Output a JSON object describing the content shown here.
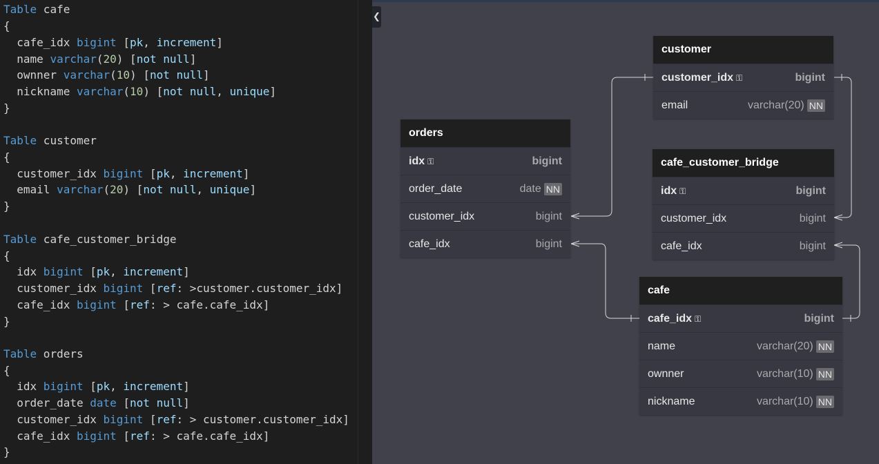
{
  "editor": {
    "lines": [
      [
        [
          "kw",
          "Table"
        ],
        [
          "plain",
          " cafe"
        ]
      ],
      [
        [
          "plain",
          "{"
        ]
      ],
      [
        [
          "plain",
          "  cafe_idx "
        ],
        [
          "ty",
          "bigint"
        ],
        [
          "plain",
          " ["
        ],
        [
          "op",
          "pk"
        ],
        [
          "plain",
          ", "
        ],
        [
          "op",
          "increment"
        ],
        [
          "plain",
          "]"
        ]
      ],
      [
        [
          "plain",
          "  name "
        ],
        [
          "ty",
          "varchar"
        ],
        [
          "plain",
          "("
        ],
        [
          "num",
          "20"
        ],
        [
          "plain",
          ") ["
        ],
        [
          "op",
          "not null"
        ],
        [
          "plain",
          "]"
        ]
      ],
      [
        [
          "plain",
          "  ownner "
        ],
        [
          "ty",
          "varchar"
        ],
        [
          "plain",
          "("
        ],
        [
          "num",
          "10"
        ],
        [
          "plain",
          ") ["
        ],
        [
          "op",
          "not null"
        ],
        [
          "plain",
          "]"
        ]
      ],
      [
        [
          "plain",
          "  nickname "
        ],
        [
          "ty",
          "varchar"
        ],
        [
          "plain",
          "("
        ],
        [
          "num",
          "10"
        ],
        [
          "plain",
          ") ["
        ],
        [
          "op",
          "not null"
        ],
        [
          "plain",
          ", "
        ],
        [
          "op",
          "unique"
        ],
        [
          "plain",
          "]"
        ]
      ],
      [
        [
          "plain",
          "}"
        ]
      ],
      [],
      [
        [
          "kw",
          "Table"
        ],
        [
          "plain",
          " customer"
        ]
      ],
      [
        [
          "plain",
          "{"
        ]
      ],
      [
        [
          "plain",
          "  customer_idx "
        ],
        [
          "ty",
          "bigint"
        ],
        [
          "plain",
          " ["
        ],
        [
          "op",
          "pk"
        ],
        [
          "plain",
          ", "
        ],
        [
          "op",
          "increment"
        ],
        [
          "plain",
          "]"
        ]
      ],
      [
        [
          "plain",
          "  email "
        ],
        [
          "ty",
          "varchar"
        ],
        [
          "plain",
          "("
        ],
        [
          "num",
          "20"
        ],
        [
          "plain",
          ") ["
        ],
        [
          "op",
          "not null"
        ],
        [
          "plain",
          ", "
        ],
        [
          "op",
          "unique"
        ],
        [
          "plain",
          "]"
        ]
      ],
      [
        [
          "plain",
          "}"
        ]
      ],
      [],
      [
        [
          "kw",
          "Table"
        ],
        [
          "plain",
          " cafe_customer_bridge"
        ]
      ],
      [
        [
          "plain",
          "{"
        ]
      ],
      [
        [
          "plain",
          "  idx "
        ],
        [
          "ty",
          "bigint"
        ],
        [
          "plain",
          " ["
        ],
        [
          "op",
          "pk"
        ],
        [
          "plain",
          ", "
        ],
        [
          "op",
          "increment"
        ],
        [
          "plain",
          "]"
        ]
      ],
      [
        [
          "plain",
          "  customer_idx "
        ],
        [
          "ty",
          "bigint"
        ],
        [
          "plain",
          " ["
        ],
        [
          "op",
          "ref"
        ],
        [
          "plain",
          ": >customer.customer_idx]"
        ]
      ],
      [
        [
          "plain",
          "  cafe_idx "
        ],
        [
          "ty",
          "bigint"
        ],
        [
          "plain",
          " ["
        ],
        [
          "op",
          "ref"
        ],
        [
          "plain",
          ": > cafe.cafe_idx]"
        ]
      ],
      [
        [
          "plain",
          "}"
        ]
      ],
      [],
      [
        [
          "kw",
          "Table"
        ],
        [
          "plain",
          " orders"
        ]
      ],
      [
        [
          "plain",
          "{"
        ]
      ],
      [
        [
          "plain",
          "  idx "
        ],
        [
          "ty",
          "bigint"
        ],
        [
          "plain",
          " ["
        ],
        [
          "op",
          "pk"
        ],
        [
          "plain",
          ", "
        ],
        [
          "op",
          "increment"
        ],
        [
          "plain",
          "]"
        ]
      ],
      [
        [
          "plain",
          "  order_date "
        ],
        [
          "ty",
          "date"
        ],
        [
          "plain",
          " ["
        ],
        [
          "op",
          "not null"
        ],
        [
          "plain",
          "]"
        ]
      ],
      [
        [
          "plain",
          "  customer_idx "
        ],
        [
          "ty",
          "bigint"
        ],
        [
          "plain",
          " ["
        ],
        [
          "op",
          "ref"
        ],
        [
          "plain",
          ": > customer.customer_idx]"
        ]
      ],
      [
        [
          "plain",
          "  cafe_idx "
        ],
        [
          "ty",
          "bigint"
        ],
        [
          "plain",
          " ["
        ],
        [
          "op",
          "ref"
        ],
        [
          "plain",
          ": > cafe.cafe_idx]"
        ]
      ],
      [
        [
          "plain",
          "}"
        ]
      ]
    ]
  },
  "collapse_icon": "chevron-left-icon",
  "tables": {
    "customer": {
      "name": "customer",
      "fields": [
        {
          "name": "customer_idx",
          "type": "bigint",
          "pk": true,
          "nn": false
        },
        {
          "name": "email",
          "type": "varchar(20)",
          "pk": false,
          "nn": true
        }
      ]
    },
    "orders": {
      "name": "orders",
      "fields": [
        {
          "name": "idx",
          "type": "bigint",
          "pk": true,
          "nn": false
        },
        {
          "name": "order_date",
          "type": "date",
          "pk": false,
          "nn": true
        },
        {
          "name": "customer_idx",
          "type": "bigint",
          "pk": false,
          "nn": false
        },
        {
          "name": "cafe_idx",
          "type": "bigint",
          "pk": false,
          "nn": false
        }
      ]
    },
    "cafe_customer_bridge": {
      "name": "cafe_customer_bridge",
      "fields": [
        {
          "name": "idx",
          "type": "bigint",
          "pk": true,
          "nn": false
        },
        {
          "name": "customer_idx",
          "type": "bigint",
          "pk": false,
          "nn": false
        },
        {
          "name": "cafe_idx",
          "type": "bigint",
          "pk": false,
          "nn": false
        }
      ]
    },
    "cafe": {
      "name": "cafe",
      "fields": [
        {
          "name": "cafe_idx",
          "type": "bigint",
          "pk": true,
          "nn": false
        },
        {
          "name": "name",
          "type": "varchar(20)",
          "pk": false,
          "nn": true
        },
        {
          "name": "ownner",
          "type": "varchar(10)",
          "pk": false,
          "nn": true
        },
        {
          "name": "nickname",
          "type": "varchar(10)",
          "pk": false,
          "nn": true
        }
      ]
    }
  },
  "nn_label": "NN",
  "colors": {
    "canvas": "#41414b",
    "table_header": "#1f1f1f",
    "table_body": "#383842",
    "keyword": "#569cd6",
    "number": "#b5cea8"
  }
}
